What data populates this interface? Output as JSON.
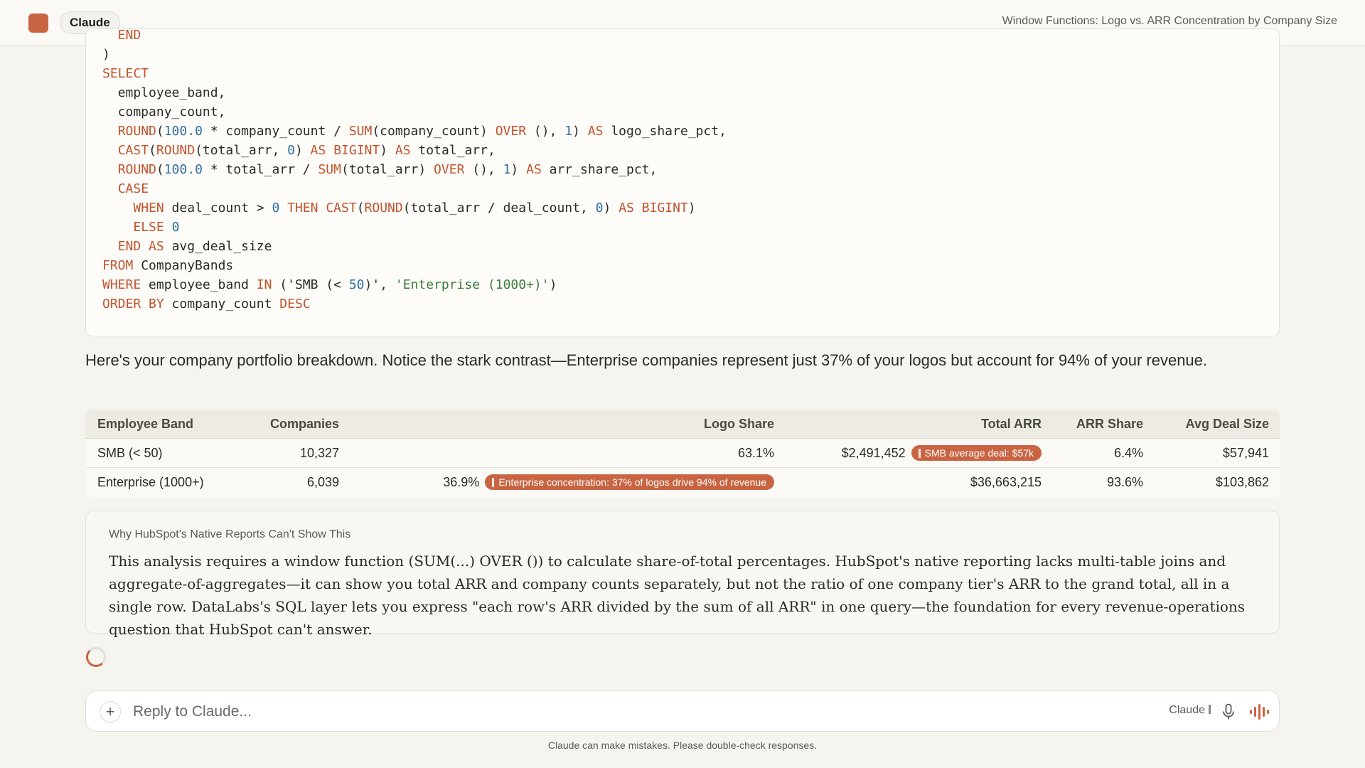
{
  "header": {
    "app_name": "Claude",
    "conversation_title": "Window Functions: Logo vs. ARR Concentration by Company Size"
  },
  "code_lines": [
    [
      {
        "t": "  END",
        "c": "kw"
      }
    ],
    [
      {
        "t": ")"
      }
    ],
    [
      {
        "t": "SELECT",
        "c": "kw"
      }
    ],
    [
      {
        "t": "  employee_band,"
      }
    ],
    [
      {
        "t": "  company_count,"
      }
    ],
    [
      {
        "t": "  "
      },
      {
        "t": "ROUND",
        "c": "kw"
      },
      {
        "t": "("
      },
      {
        "t": "100.0",
        "c": "num"
      },
      {
        "t": " * company_count / "
      },
      {
        "t": "SUM",
        "c": "kw"
      },
      {
        "t": "(company_count) "
      },
      {
        "t": "OVER",
        "c": "kw"
      },
      {
        "t": " (), "
      },
      {
        "t": "1",
        "c": "num"
      },
      {
        "t": ") "
      },
      {
        "t": "AS",
        "c": "kw"
      },
      {
        "t": " logo_share_pct,"
      }
    ],
    [
      {
        "t": "  "
      },
      {
        "t": "CAST",
        "c": "kw"
      },
      {
        "t": "("
      },
      {
        "t": "ROUND",
        "c": "kw"
      },
      {
        "t": "(total_arr, "
      },
      {
        "t": "0",
        "c": "num"
      },
      {
        "t": ") "
      },
      {
        "t": "AS",
        "c": "kw"
      },
      {
        "t": " "
      },
      {
        "t": "BIGINT",
        "c": "kw"
      },
      {
        "t": ") "
      },
      {
        "t": "AS",
        "c": "kw"
      },
      {
        "t": " total_arr,"
      }
    ],
    [
      {
        "t": "  "
      },
      {
        "t": "ROUND",
        "c": "kw"
      },
      {
        "t": "("
      },
      {
        "t": "100.0",
        "c": "num"
      },
      {
        "t": " * total_arr / "
      },
      {
        "t": "SUM",
        "c": "kw"
      },
      {
        "t": "(total_arr) "
      },
      {
        "t": "OVER",
        "c": "kw"
      },
      {
        "t": " (), "
      },
      {
        "t": "1",
        "c": "num"
      },
      {
        "t": ") "
      },
      {
        "t": "AS",
        "c": "kw"
      },
      {
        "t": " arr_share_pct,"
      }
    ],
    [
      {
        "t": "  "
      },
      {
        "t": "CASE",
        "c": "kw"
      }
    ],
    [
      {
        "t": "    "
      },
      {
        "t": "WHEN",
        "c": "kw"
      },
      {
        "t": " deal_count > "
      },
      {
        "t": "0",
        "c": "num"
      },
      {
        "t": " "
      },
      {
        "t": "THEN",
        "c": "kw"
      },
      {
        "t": " "
      },
      {
        "t": "CAST",
        "c": "kw"
      },
      {
        "t": "("
      },
      {
        "t": "ROUND",
        "c": "kw"
      },
      {
        "t": "(total_arr / deal_count, "
      },
      {
        "t": "0",
        "c": "num"
      },
      {
        "t": ") "
      },
      {
        "t": "AS",
        "c": "kw"
      },
      {
        "t": " "
      },
      {
        "t": "BIGINT",
        "c": "kw"
      },
      {
        "t": ")"
      }
    ],
    [
      {
        "t": "    "
      },
      {
        "t": "ELSE",
        "c": "kw"
      },
      {
        "t": " "
      },
      {
        "t": "0",
        "c": "num"
      }
    ],
    [
      {
        "t": "  "
      },
      {
        "t": "END",
        "c": "kw"
      },
      {
        "t": " "
      },
      {
        "t": "AS",
        "c": "kw"
      },
      {
        "t": " avg_deal_size"
      }
    ],
    [
      {
        "t": "FROM",
        "c": "kw"
      },
      {
        "t": " CompanyBands"
      }
    ],
    [
      {
        "t": "WHERE",
        "c": "kw"
      },
      {
        "t": " employee_band "
      },
      {
        "t": "IN",
        "c": "kw"
      },
      {
        "t": " ('SMB (< "
      },
      {
        "t": "50",
        "c": "num"
      },
      {
        "t": ")', "
      },
      {
        "t": "'Enterprise (1000+)'",
        "c": "str"
      },
      {
        "t": ")"
      }
    ],
    [
      {
        "t": "ORDER BY",
        "c": "kw"
      },
      {
        "t": " company_count "
      },
      {
        "t": "DESC",
        "c": "kw"
      }
    ]
  ],
  "summary_text": "Here's your company portfolio breakdown. Notice the stark contrast—Enterprise companies represent just 37% of your logos but account for 94% of your revenue.",
  "table": {
    "headers": {
      "band": "Employee Band",
      "companies": "Companies",
      "logo_share": "Logo Share",
      "total_arr": "Total ARR",
      "arr_share": "ARR Share",
      "avg_deal": "Avg Deal Size"
    },
    "rows": [
      {
        "band": "SMB (< 50)",
        "companies": "10,327",
        "logo_share": "63.1%",
        "total_arr": "$2,491,452",
        "arr_share": "6.4%",
        "avg_deal": "$57,941"
      },
      {
        "band": "Enterprise (1000+)",
        "companies": "6,039",
        "logo_share": "36.9%",
        "total_arr": "$36,663,215",
        "arr_share": "93.6%",
        "avg_deal": "$103,862"
      }
    ],
    "annotations": {
      "smb_arr": "SMB average deal: $57k",
      "enterprise_logo": "Enterprise concentration: 37% of logos drive 94% of revenue"
    }
  },
  "callout": {
    "label": "Why HubSpot's Native Reports Can't Show This",
    "body": "This analysis requires a window function (SUM(...) OVER ()) to calculate share-of-total percentages. HubSpot's native reporting lacks multi-table joins and aggregate-of-aggregates—it can show you total ARR and company counts separately, but not the ratio of one company tier's ARR to the grand total, all in a single row. DataLabs's SQL layer lets you express \"each row's ARR divided by the sum of all ARR\" in one query—the foundation for every revenue-operations question that HubSpot can't answer."
  },
  "composer": {
    "placeholder": "Reply to Claude...",
    "model_label": "Claude"
  },
  "disclaimer": "Claude can make mistakes. Please double-check responses.",
  "colors": {
    "accent": "#c96442",
    "keyword": "#c2532c",
    "number": "#2f6f9f",
    "string": "#3d7a3a"
  }
}
